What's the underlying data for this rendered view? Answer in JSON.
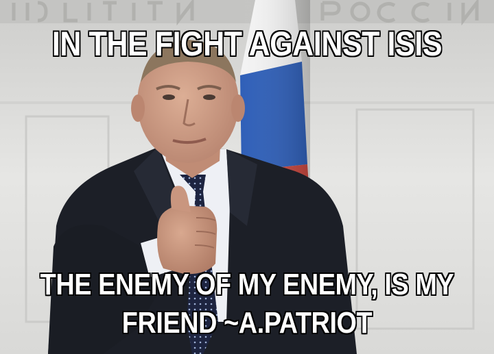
{
  "meme": {
    "top_text": "IN THE FIGHT AGAINST ISIS",
    "bottom_text_line1": "THE ENEMY OF MY ENEMY, IS MY",
    "bottom_text_line2": "FRIEND ~A.PATRIOT"
  },
  "scene": {
    "subject": "man-in-suit-thumbs-up",
    "colors": {
      "wall": "#e3e3e1",
      "suit": "#1c1f27",
      "shirt": "#eef0f5",
      "tie": "#1d2440",
      "skin": "#c99a82",
      "flag_white": "#f4f4f4",
      "flag_blue": "#2f5fb8",
      "caption_fill": "#ffffff",
      "caption_outline": "#000000"
    }
  }
}
